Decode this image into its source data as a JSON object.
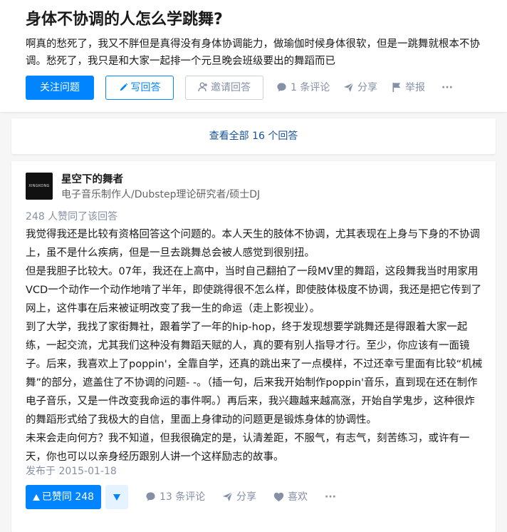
{
  "question": {
    "title": "身体不协调的人怎么学跳舞?",
    "detail": "啊真的愁死了，我又不胖但是真得没有身体协调能力，做瑜伽时候身体很软，但是一跳舞就根本不协调。愁死了，我只是和大家一起排一个元旦晚会班级要出的舞蹈而已",
    "follow_label": "关注问题",
    "write_label": "写回答",
    "invite_label": "邀请回答",
    "comments_label": "1 条评论",
    "share_label": "分享",
    "report_label": "举报",
    "more_label": "···"
  },
  "view_all": {
    "label": "查看全部 16 个回答"
  },
  "answer": {
    "author": {
      "name": "星空下的舞者",
      "headline": "电子音乐制作人/Dubstep理论研究者/硕士DJ",
      "avatar_text": "XINGKONG"
    },
    "vote_summary": "248 人赞同了该回答",
    "paragraphs": [
      "我觉得我还是比较有资格回答这个问题的。本人天生的肢体不协调，尤其表现在上身与下身的不协调上，虽不是什么疾病，但是一旦去跳舞总会被人感觉到很别扭。",
      "但是我胆子比较大。07年，我还在上高中，当时自己翻拍了一段MV里的舞蹈，这段舞我当时用家用VCD一个动作一个动作地啃了半年，即使跳得很不怎么样，即使肢体极度不协调，我还是把它传到了网上，这件事在后来被证明改变了我一生的命运（走上影视业）。",
      "到了大学，我找了家街舞社，跟着学了一年的hip-hop，终于发现想要学跳舞还是得跟着大家一起练，一起交流，尤其我们这种没有舞蹈天赋的人，真的要有别人指导才行。至少，你应该有一面镜子。后来，我喜欢上了poppin'，全靠自学，还真的跳出来了一点模样，不过还幸亏里面有比较“机械舞”的部分，遮盖住了不协调的问题- -。（插一句，后来我开始制作poppin'音乐，直到现在还在制作电子音乐，又是一件改变我命运的事件啊。）再后来，我兴趣越来越高涨，开始自学鬼步，这种很炸的舞蹈形式给了我极大的自信，里面上身律动的问题更是锻炼身体的协调性。",
      "未来会走向何方？我不知道，但我很确定的是，认清差距，不服气，有志气，刻苦练习，或许有一天，你也可以以亲身经历跟别人讲一个这样励志的故事。"
    ],
    "date": "发布于 2015-01-18",
    "upvote_label": "已赞同 248",
    "comments_label": "13 条评论",
    "share_label": "分享",
    "like_label": "喜欢",
    "more_label": "···"
  },
  "colors": {
    "accent": "#0084ff",
    "meta": "#8590a6",
    "link": "#175199",
    "background": "#f6f6f6"
  }
}
